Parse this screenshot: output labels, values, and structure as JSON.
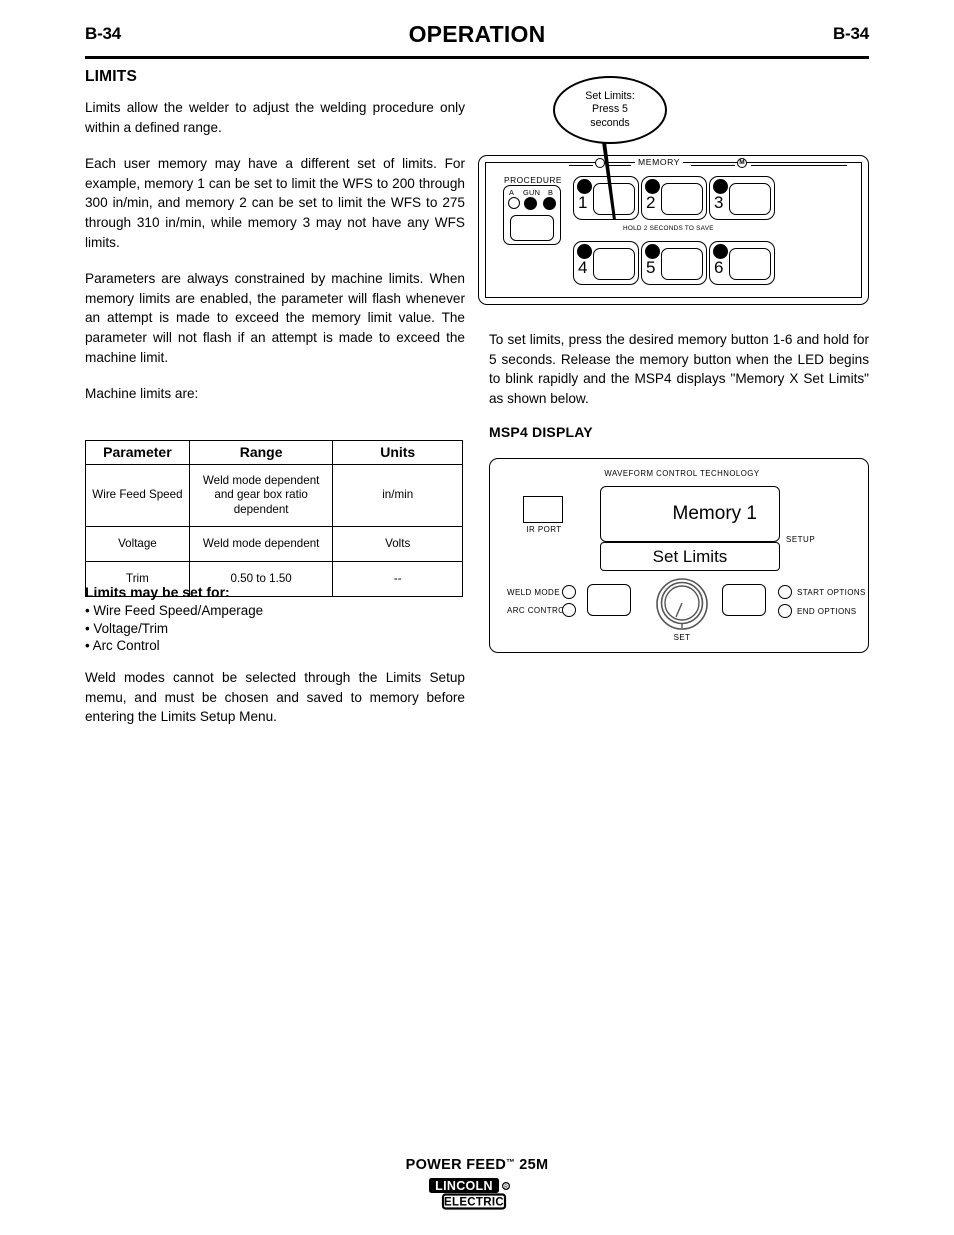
{
  "header": {
    "page_left": "B-34",
    "title": "OPERATION",
    "page_right": "B-34"
  },
  "left_column": {
    "section_title": "LIMITS",
    "paragraphs": [
      "Limits allow the welder to adjust the welding procedure only within a defined range.",
      "Each user memory may have a different set of limits. For example, memory 1 can be set to limit the WFS to 200 through 300 in/min, and memory 2 can be set to limit the WFS to 275 through 310 in/min, while memory 3 may not have any WFS limits.",
      "Parameters are always constrained by machine limits. When memory limits are enabled, the parameter will flash whenever an attempt is made to exceed the memory limit value.  The parameter will not flash if an attempt is made to exceed the machine limit.",
      "Machine limits are:"
    ],
    "closing_paragraph": "Weld modes cannot be selected through the Limits Setup memu, and must be chosen and saved to memory before entering the Limits Setup Menu."
  },
  "limits_table": {
    "headers": [
      "Parameter",
      "Range",
      "Units"
    ],
    "rows": [
      {
        "parameter": "Wire Feed Speed",
        "range": "Weld mode dependent and gear box ratio dependent",
        "units": "in/min"
      },
      {
        "parameter": "Voltage",
        "range": "Weld mode dependent",
        "units": "Volts"
      },
      {
        "parameter": "Trim",
        "range": "0.50 to 1.50",
        "units": "--"
      }
    ]
  },
  "limits_list": {
    "heading": "Limits may be set for:",
    "items": [
      "• Wire Feed Speed/Amperage",
      "• Voltage/Trim",
      "• Arc Control"
    ]
  },
  "right_column": {
    "instructions": "To set limits, press the desired memory button 1-6 and hold for 5 seconds.  Release the memory button when the LED begins to blink rapidly and the MSP4 displays \"Memory X Set Limits\" as shown below.",
    "msp4_heading": "MSP4 DISPLAY"
  },
  "callout": {
    "line1": "Set Limits:",
    "line2": "Press 5",
    "line3": "seconds"
  },
  "memory_panel": {
    "memory_label": "MEMORY",
    "procedure_label": "PROCEDURE",
    "procedure_a": "A",
    "procedure_gun": "GUN",
    "procedure_b": "B",
    "hold_note": "HOLD 2 SECONDS TO SAVE",
    "left_icon": "gun-icon",
    "right_icon": "M",
    "buttons": [
      "1",
      "2",
      "3",
      "4",
      "5",
      "6"
    ]
  },
  "msp4_panel": {
    "waveform_text": "WAVEFORM CONTROL TECHNOLOGY",
    "display_line1": "Memory  1",
    "display_line2": "Set Limits",
    "ir_port_label": "IR PORT",
    "setup_label": "SETUP",
    "weld_mode_label": "WELD MODE",
    "arc_control_label": "ARC CONTROL",
    "start_options_label": "START OPTIONS",
    "end_options_label": "END OPTIONS",
    "set_label": "SET"
  },
  "footer": {
    "product": "POWER FEED",
    "trademark": "™",
    "model": " 25M",
    "brand_top": "LINCOLN",
    "brand_reg": "®",
    "brand_bottom": "ELECTRIC"
  }
}
